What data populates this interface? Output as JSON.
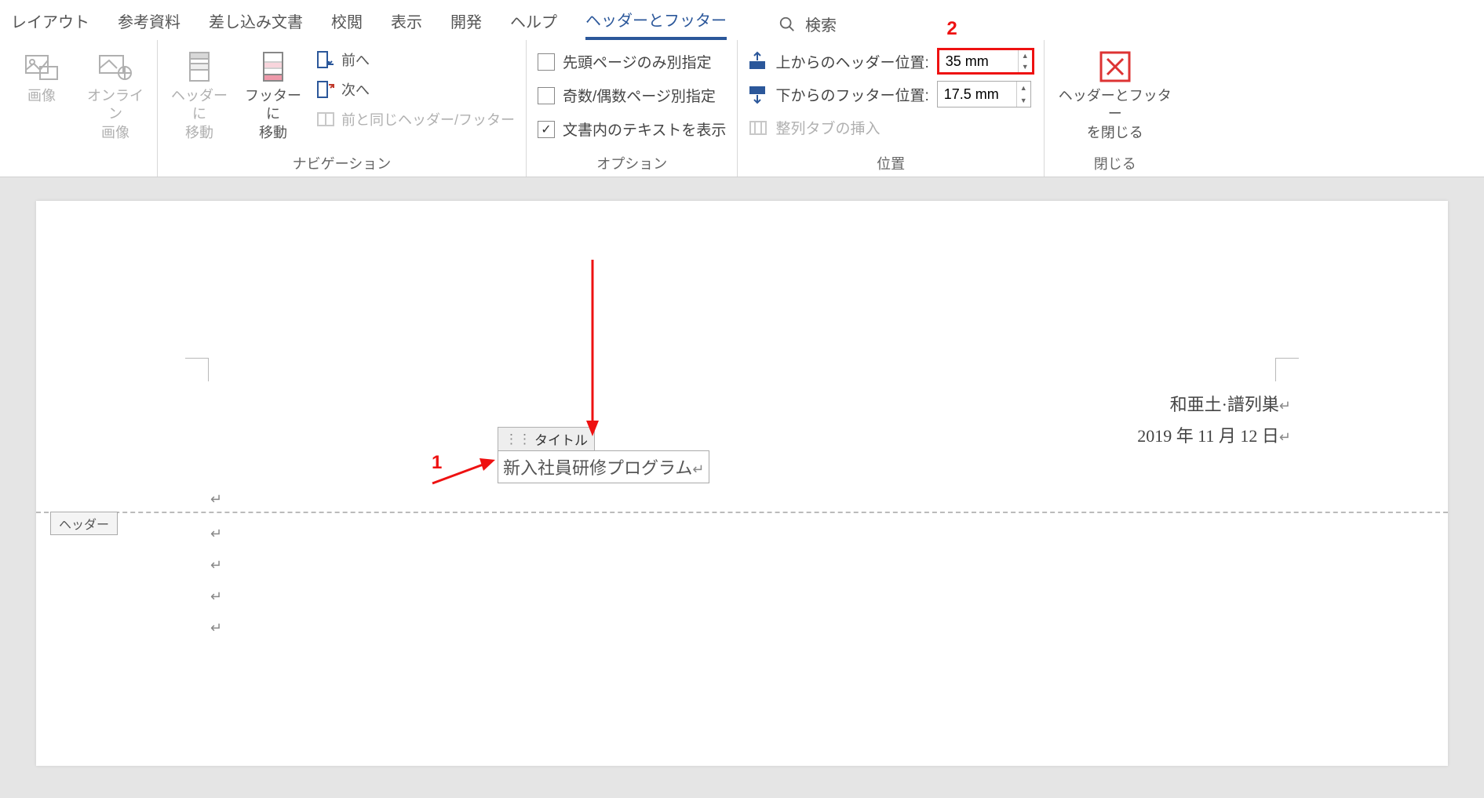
{
  "tabs": {
    "layout": "レイアウト",
    "references": "参考資料",
    "mailings": "差し込み文書",
    "review": "校閲",
    "view": "表示",
    "developer": "開発",
    "help": "ヘルプ",
    "header_footer": "ヘッダーとフッター"
  },
  "search": {
    "label": "検索"
  },
  "groups": {
    "insert": {
      "image": "画像",
      "online_image": "オンライン\n画像"
    },
    "nav": {
      "goto_header": "ヘッダーに\n移動",
      "goto_footer": "フッターに\n移動",
      "prev": "前へ",
      "next": "次へ",
      "link_prev": "前と同じヘッダー/フッター",
      "label": "ナビゲーション"
    },
    "options": {
      "first_page": "先頭ページのみ別指定",
      "odd_even": "奇数/偶数ページ別指定",
      "show_text": "文書内のテキストを表示",
      "label": "オプション"
    },
    "position": {
      "header_from_top": "上からのヘッダー位置:",
      "footer_from_bottom": "下からのフッター位置:",
      "header_value": "35 mm",
      "footer_value": "17.5 mm",
      "align_tab": "整列タブの挿入",
      "label": "位置"
    },
    "close": {
      "button": "ヘッダーとフッター\nを閉じる",
      "label": "閉じる"
    }
  },
  "annotations": {
    "one": "1",
    "two": "2"
  },
  "doc": {
    "author": "和亜土·譜列巣",
    "date": "2019 年 11 月 12 日",
    "title_tag": "タイトル",
    "title_value": "新入社員研修プログラム",
    "header_tab": "ヘッダー"
  }
}
